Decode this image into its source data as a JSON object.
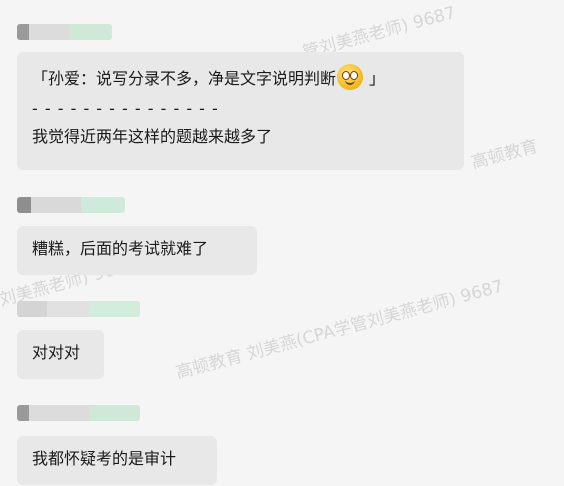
{
  "watermark": {
    "text_full": "高顿教育  刘美燕(CPA学管刘美燕老师) 9687",
    "text_short": "高顿教育",
    "text_mid": "管刘美燕老师) 9687"
  },
  "messages": [
    {
      "lines": [
        "「孙爱：说写分录不多，净是文字说明判断",
        "」",
        "- - - - - - - - - - - - - - -",
        "我觉得近两年这样的题越来越多了"
      ],
      "emoji": "grinning-face-emoji"
    },
    {
      "lines": [
        "糟糕，后面的考试就难了"
      ]
    },
    {
      "lines": [
        "对对对"
      ]
    },
    {
      "lines": [
        "我都怀疑考的是审计"
      ]
    }
  ],
  "colors": {
    "background": "#f5f5f5",
    "bubble": "#e8e8e8",
    "watermark": "#d6d6d6"
  }
}
